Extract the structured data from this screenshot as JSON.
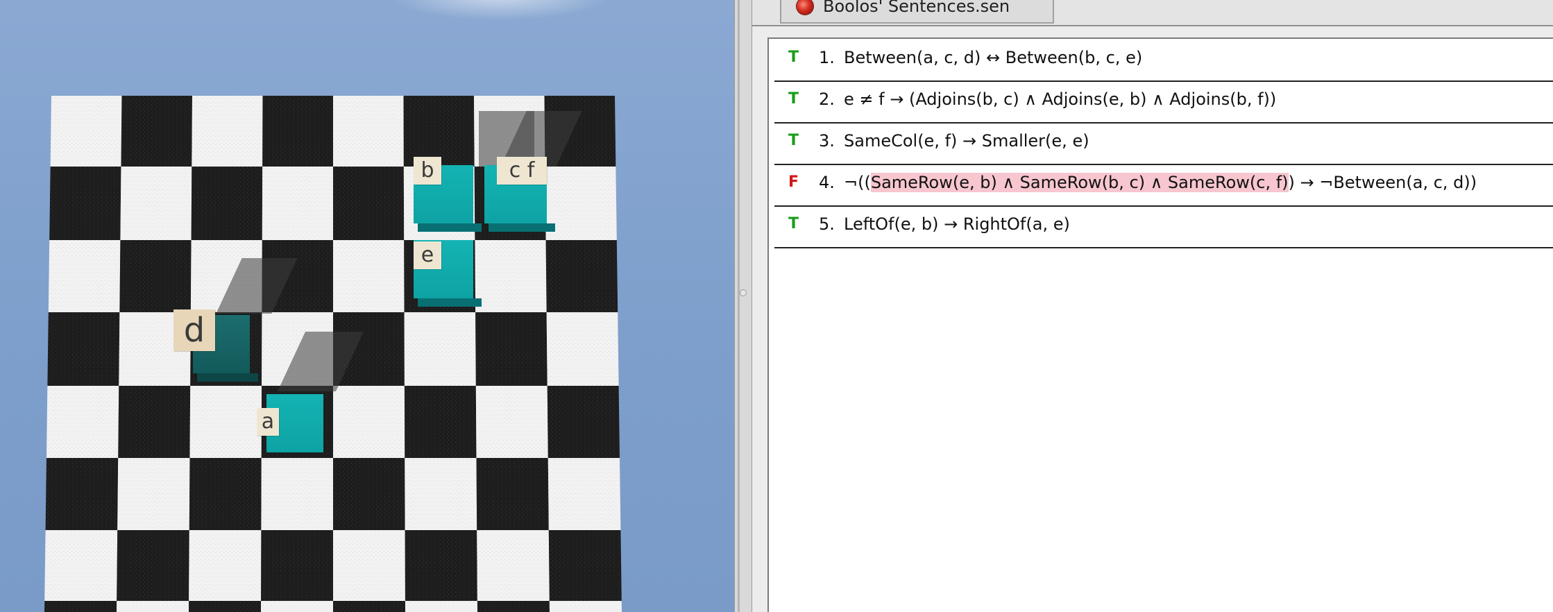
{
  "editor": {
    "tab_label": "Boolos' Sentences.sen",
    "tab_icon": "red-ball-icon"
  },
  "sentences": [
    {
      "truth": "T",
      "number": "1.",
      "formula": "Between(a, c, d) ↔ Between(b, c, e)"
    },
    {
      "truth": "T",
      "number": "2.",
      "formula": "e ≠ f → (Adjoins(b, c) ∧ Adjoins(e, b) ∧ Adjoins(b, f))"
    },
    {
      "truth": "T",
      "number": "3.",
      "formula": "SameCol(e, f) → Smaller(e, e)"
    },
    {
      "truth": "F",
      "number": "4.",
      "formula_prefix": "¬((",
      "formula_highlight": "SameRow(e, b) ∧ SameRow(b, c) ∧ SameRow(c, f)",
      "formula_suffix": ") → ¬Between(a, c, d))"
    },
    {
      "truth": "T",
      "number": "5.",
      "formula": "LeftOf(e, b) → RightOf(a, e)"
    }
  ],
  "world": {
    "blocks": [
      {
        "label": "b",
        "color": "teal"
      },
      {
        "label": "c f",
        "color": "teal"
      },
      {
        "label": "e",
        "color": "teal"
      },
      {
        "label": "d",
        "color": "dark-teal"
      },
      {
        "label": "a",
        "color": "teal"
      }
    ]
  },
  "colors": {
    "true": "#1a9d1a",
    "false": "#d11818",
    "highlight": "#f7c6cf",
    "block": "#0ea3a4",
    "block_dark": "#135a5b",
    "sky": "#7d9ecb"
  }
}
